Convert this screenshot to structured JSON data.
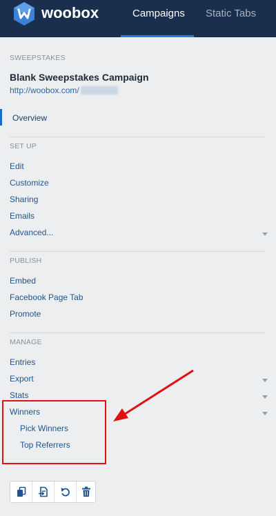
{
  "header": {
    "brand": "woobox",
    "tabs": [
      "Campaigns",
      "Static Tabs"
    ],
    "active_tab": "Campaigns"
  },
  "campaign": {
    "type_label": "SWEEPSTAKES",
    "name": "Blank Sweepstakes Campaign",
    "url": "http://woobox.com/"
  },
  "nav": {
    "overview": "Overview",
    "setup_label": "SET UP",
    "setup_items": [
      "Edit",
      "Customize",
      "Sharing",
      "Emails",
      "Advanced..."
    ],
    "publish_label": "PUBLISH",
    "publish_items": [
      "Embed",
      "Facebook Page Tab",
      "Promote"
    ],
    "manage_label": "MANAGE",
    "manage_items": [
      "Entries",
      "Export",
      "Stats",
      "Winners"
    ],
    "winners_sub": [
      "Pick Winners",
      "Top Referrers"
    ]
  },
  "actions": [
    "copy-icon",
    "export-icon",
    "reset-icon",
    "trash-icon"
  ],
  "colors": {
    "header_bg": "#1a2f4d",
    "accent": "#2b7bd4",
    "link": "#1e5591",
    "annotation": "#e01010"
  }
}
